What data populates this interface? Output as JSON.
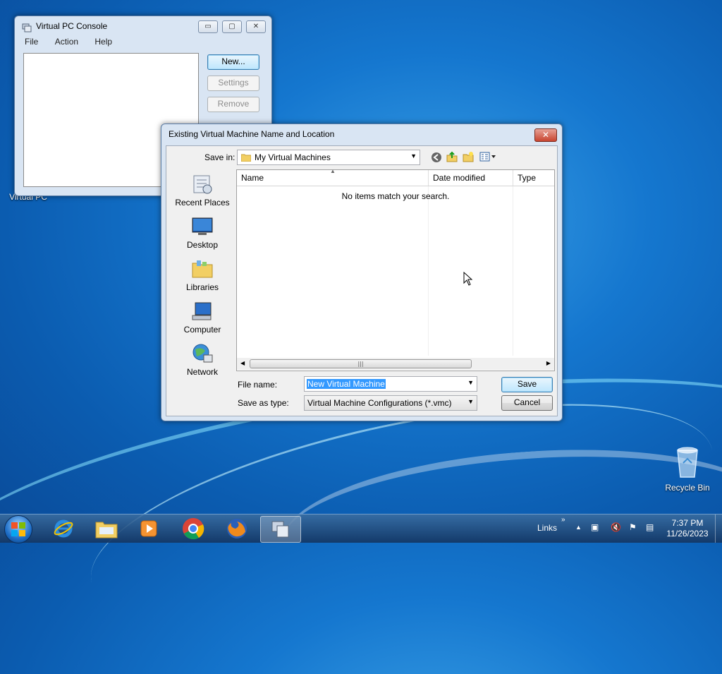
{
  "desktop": {
    "icons": [
      {
        "label": "Virtual PC",
        "icon": "virtual-pc-icon"
      },
      {
        "label": "Recycle Bin",
        "icon": "recycle-bin-icon"
      }
    ]
  },
  "console": {
    "title": "Virtual PC Console",
    "menu": [
      "File",
      "Action",
      "Help"
    ],
    "buttons": {
      "new": "New...",
      "settings": "Settings",
      "remove": "Remove"
    }
  },
  "dialog": {
    "title": "Existing Virtual Machine Name and Location",
    "save_in_label": "Save in:",
    "save_in_value": "My Virtual Machines",
    "places": [
      {
        "label": "Recent Places",
        "icon": "recent-places-icon"
      },
      {
        "label": "Desktop",
        "icon": "desktop-icon"
      },
      {
        "label": "Libraries",
        "icon": "libraries-icon"
      },
      {
        "label": "Computer",
        "icon": "computer-icon"
      },
      {
        "label": "Network",
        "icon": "network-icon"
      }
    ],
    "columns": [
      "Name",
      "Date modified",
      "Type"
    ],
    "empty_message": "No items match your search.",
    "file_name_label": "File name:",
    "file_name_value": "New Virtual Machine",
    "save_as_type_label": "Save as type:",
    "save_as_type_value": "Virtual Machine Configurations (*.vmc)",
    "save_button": "Save",
    "cancel_button": "Cancel"
  },
  "taskbar": {
    "links_label": "Links",
    "time": "7:37 PM",
    "date": "11/26/2023"
  },
  "colors": {
    "accent": "#3399ff",
    "selection": "#3399ff"
  }
}
